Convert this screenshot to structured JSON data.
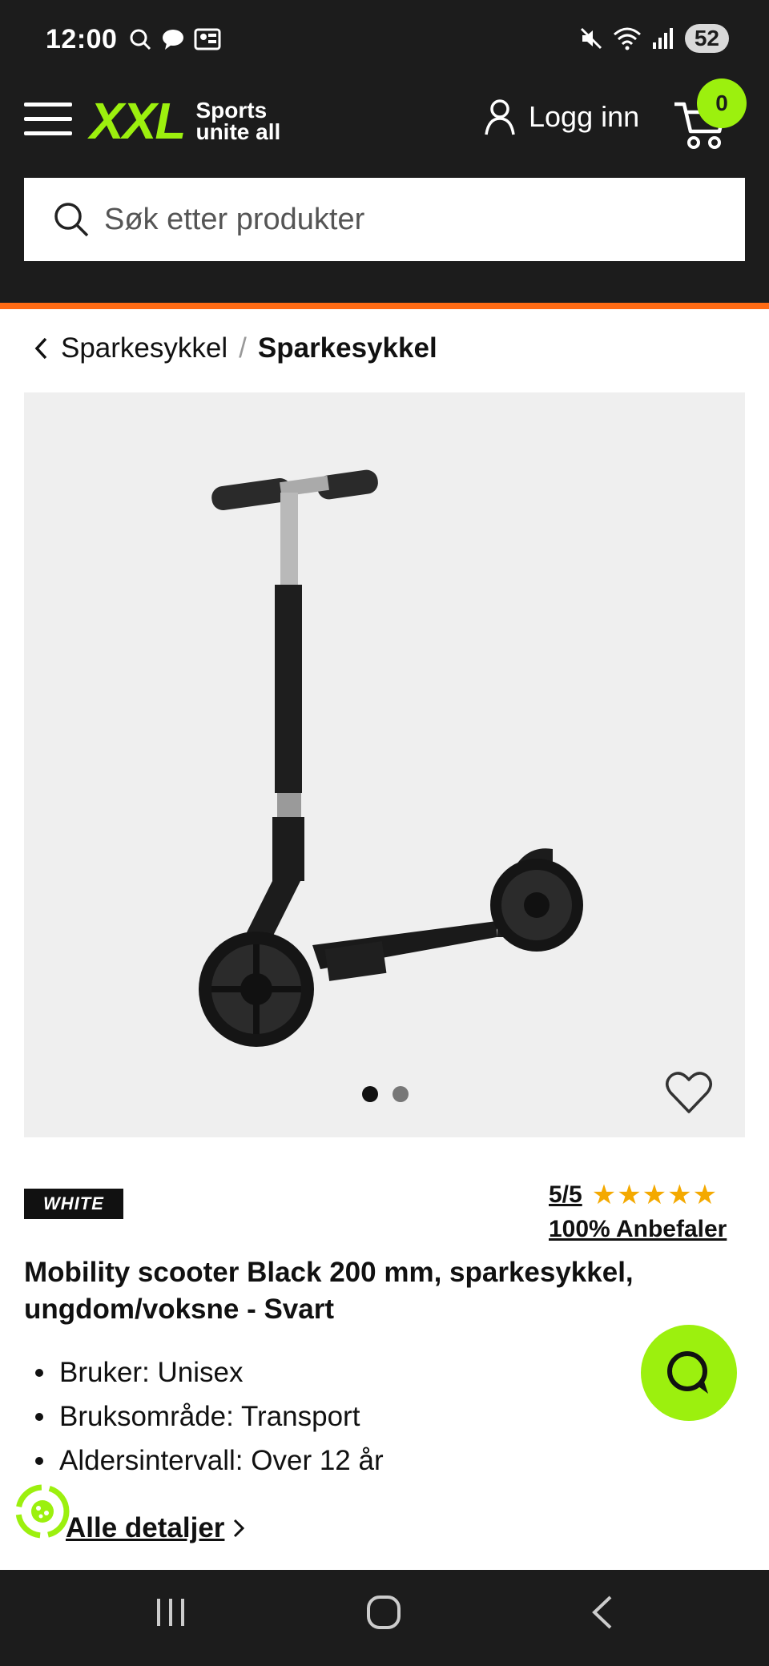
{
  "status_bar": {
    "time": "12:00",
    "battery": "52"
  },
  "header": {
    "logo_text": "XXL",
    "tagline_line1": "Sports",
    "tagline_line2": "unite all",
    "login_label": "Logg inn",
    "cart_count": "0",
    "search_placeholder": "Søk etter produkter",
    "accent_color": "#9cf00e",
    "stripe_color": "#ff6a13"
  },
  "breadcrumb": {
    "parent": "Sparkesykkel",
    "separator": "/",
    "current": "Sparkesykkel"
  },
  "gallery": {
    "image_count": 2,
    "active_index": 0
  },
  "product": {
    "brand": "WHITE",
    "rating_score": "5/5",
    "rating_stars": 5,
    "recommend_text": "100% Anbefaler",
    "title": "Mobility scooter Black 200 mm, sparkesykkel, ungdom/voksne - Svart",
    "features": [
      "Bruker: Unisex",
      "Bruksområde: Transport",
      "Aldersintervall: Over 12 år"
    ],
    "details_link": "Alle detaljer"
  }
}
